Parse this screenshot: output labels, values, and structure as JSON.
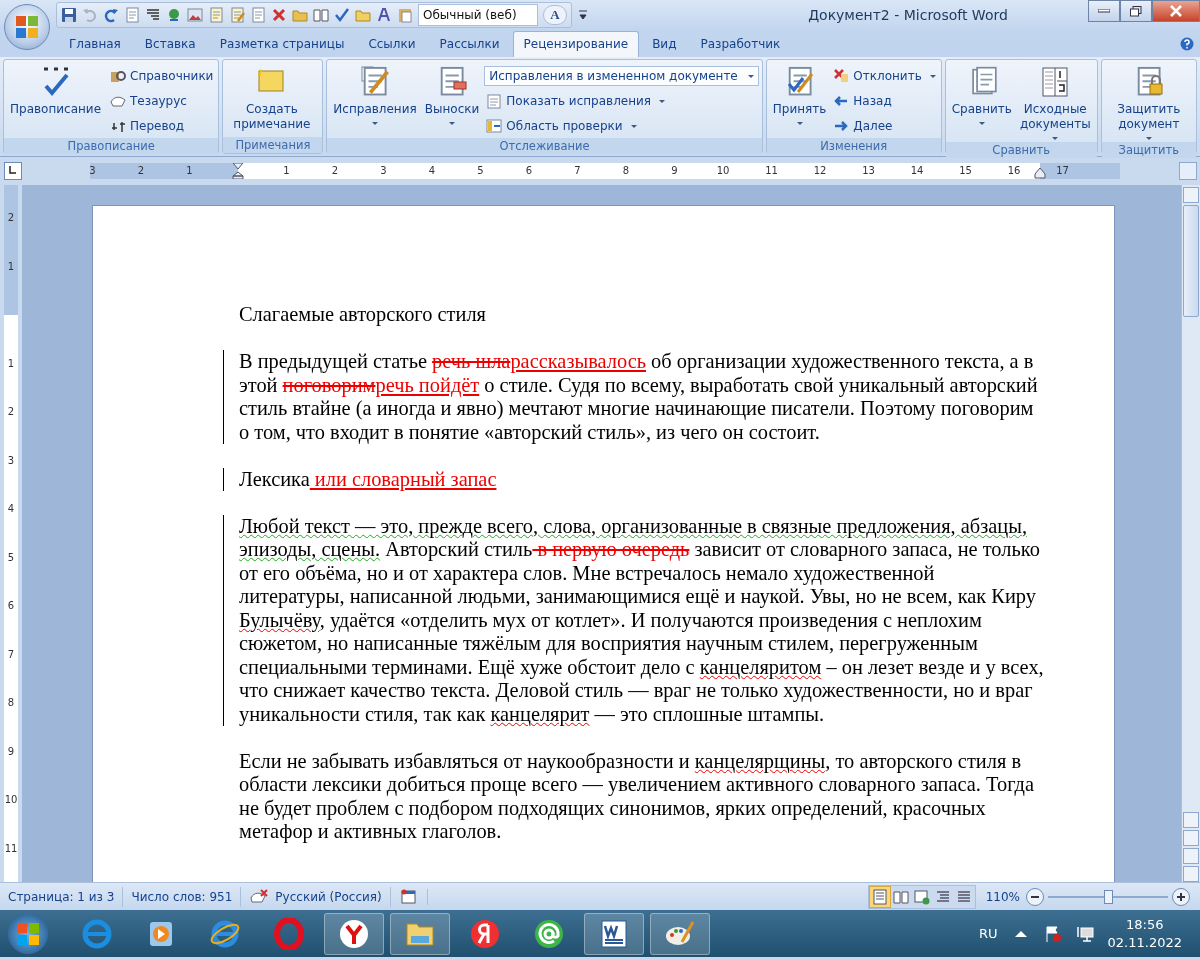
{
  "window": {
    "title": "Документ2 - Microsoft Word"
  },
  "quick_access": {
    "style_field": {
      "value": "Обычный (веб)"
    },
    "font_button": "A"
  },
  "tabs": [
    {
      "label": "Главная",
      "selected": false
    },
    {
      "label": "Вставка",
      "selected": false
    },
    {
      "label": "Разметка страницы",
      "selected": false
    },
    {
      "label": "Ссылки",
      "selected": false
    },
    {
      "label": "Рассылки",
      "selected": false
    },
    {
      "label": "Рецензирование",
      "selected": true
    },
    {
      "label": "Вид",
      "selected": false
    },
    {
      "label": "Разработчик",
      "selected": false
    }
  ],
  "ribbon": {
    "groups": [
      {
        "title": "Правописание",
        "large": [
          {
            "label": "Правописание",
            "dropdown": false
          }
        ],
        "small": [
          {
            "label": "Справочники",
            "dropdown": false
          },
          {
            "label": "Тезаурус",
            "dropdown": false
          },
          {
            "label": "Перевод",
            "dropdown": false
          }
        ]
      },
      {
        "title": "Примечания",
        "large": [
          {
            "label": "Создать примечание",
            "dropdown": false
          }
        ]
      },
      {
        "title": "Отслеживание",
        "large": [
          {
            "label": "Исправления",
            "dropdown": true
          },
          {
            "label": "Выноски",
            "dropdown": true
          }
        ],
        "combo": {
          "value": "Исправления в измененном документе"
        },
        "small": [
          {
            "label": "Показать исправления",
            "dropdown": true
          },
          {
            "label": "Область проверки",
            "dropdown": true
          }
        ]
      },
      {
        "title": "Изменения",
        "large": [
          {
            "label": "Принять",
            "dropdown": true
          }
        ],
        "small": [
          {
            "label": "Отклонить",
            "dropdown": true
          },
          {
            "label": "Назад",
            "dropdown": false
          },
          {
            "label": "Далее",
            "dropdown": false
          }
        ]
      },
      {
        "title": "Сравнить",
        "large": [
          {
            "label": "Сравнить",
            "dropdown": true
          },
          {
            "label": "Исходные документы",
            "dropdown": true
          }
        ]
      },
      {
        "title": "Защитить",
        "large": [
          {
            "label": "Защитить документ",
            "dropdown": true
          }
        ]
      }
    ]
  },
  "ruler": {
    "marks": [
      "3",
      "2",
      "1",
      "1",
      "2",
      "3",
      "4",
      "5",
      "6",
      "7",
      "8",
      "9",
      "10",
      "11",
      "12",
      "13",
      "14",
      "15",
      "16",
      "17"
    ]
  },
  "vertical_ruler": {
    "marks": [
      "2",
      "1",
      "1",
      "2",
      "3",
      "4",
      "5",
      "6",
      "7",
      "8",
      "9",
      "10",
      "11"
    ]
  },
  "document": {
    "paragraphs": [
      {
        "changed": false,
        "runs": [
          {
            "kind": "normal",
            "text": "Слагаемые авторского стиля"
          }
        ]
      },
      {
        "changed": true,
        "runs": [
          {
            "kind": "normal",
            "text": "В предыдущей статье "
          },
          {
            "kind": "deleted",
            "text": "речь шла"
          },
          {
            "kind": "inserted",
            "text": "рассказывалось"
          },
          {
            "kind": "normal",
            "text": " об организации художественного текста, а в этой "
          },
          {
            "kind": "deleted",
            "text": "поговорим"
          },
          {
            "kind": "inserted",
            "text": "речь пойдёт"
          },
          {
            "kind": "normal",
            "text": " о стиле. Судя по всему, выработать свой уникальный авторский стиль втайне (а иногда и явно) мечтают многие начинающие писатели. Поэтому поговорим о том, что входит в понятие «авторский стиль», из чего он состоит."
          }
        ]
      },
      {
        "changed": true,
        "runs": [
          {
            "kind": "normal",
            "text": "Лексика"
          },
          {
            "kind": "inserted",
            "text": " или словарный запас"
          }
        ]
      },
      {
        "changed": true,
        "runs": [
          {
            "kind": "grammar",
            "text": "Любой текст — это, прежде всего, слова, организованные в связные предложения, абзацы, эпизоды, сцены."
          },
          {
            "kind": "normal",
            "text": " Авторский стиль"
          },
          {
            "kind": "deleted",
            "text": " в первую очередь"
          },
          {
            "kind": "normal",
            "text": " зависит от словарного запаса, не только от его объёма, но и от характера слов. Мне встречалось немало художественной литературы, написанной людьми, занимающимися ещё и наукой. Увы, но не всем, как Киру "
          },
          {
            "kind": "spelling",
            "text": "Булычёву"
          },
          {
            "kind": "normal",
            "text": ", удаётся «отделить мух от котлет». И получаются произведения с неплохим сюжетом, но написанные тяжёлым для восприятия научным стилем, перегруженным специальными терминами. Ещё хуже обстоит дело с "
          },
          {
            "kind": "spelling",
            "text": "канцеляритом"
          },
          {
            "kind": "normal",
            "text": " – он лезет везде и у всех, что снижает качество текста. Деловой стиль — враг не только художественности, но и враг уникальности стиля, так как "
          },
          {
            "kind": "spelling",
            "text": "канцелярит"
          },
          {
            "kind": "normal",
            "text": " — это сплошные штампы."
          }
        ]
      },
      {
        "changed": false,
        "runs": [
          {
            "kind": "normal",
            "text": "Если не забывать избавляться от наукообразности и "
          },
          {
            "kind": "spelling",
            "text": "канцелярщины"
          },
          {
            "kind": "normal",
            "text": ", то авторского стиля в области лексики добиться проще всего — увеличением активного словарного запаса. Тогда не будет проблем с подбором подходящих синонимов, ярких определений, красочных метафор и активных глаголов."
          }
        ]
      }
    ]
  },
  "status_bar": {
    "page": "Страница: 1 из 3",
    "words": "Число слов: 951",
    "language": "Русский (Россия)",
    "views": [
      {
        "selected": true
      },
      {
        "selected": false
      },
      {
        "selected": false
      },
      {
        "selected": false
      },
      {
        "selected": false
      }
    ],
    "zoom": "110%",
    "zoom_slider": {
      "level": 0.5
    }
  },
  "taskbar": {
    "language": "RU",
    "time": "18:56",
    "date": "02.11.2022"
  }
}
